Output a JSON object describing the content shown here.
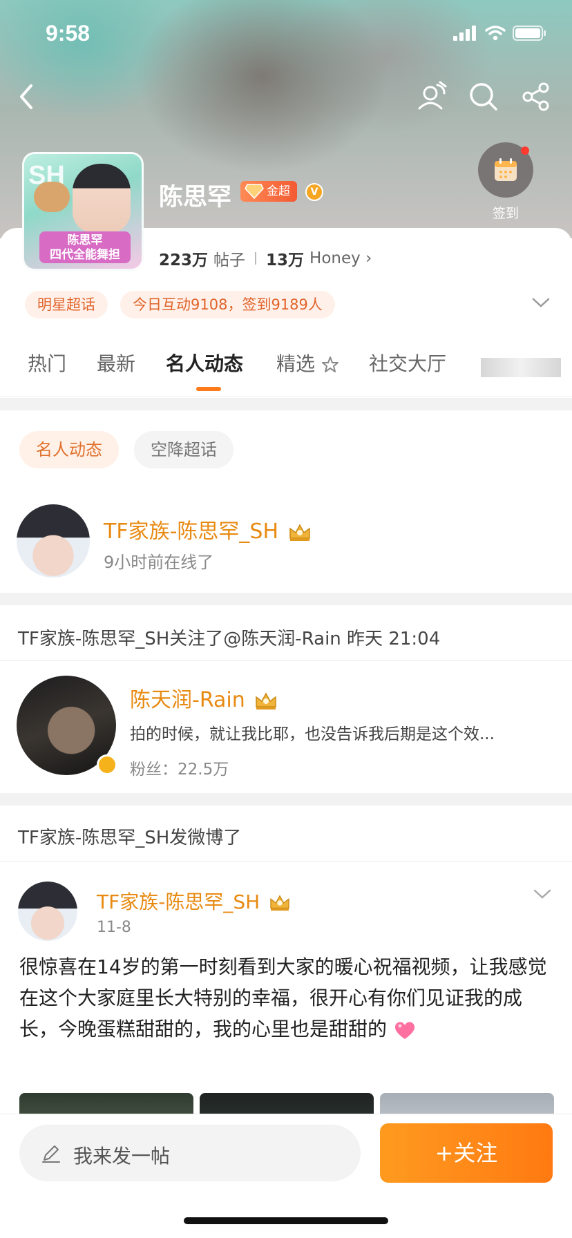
{
  "status_bar": {
    "time": "9:58"
  },
  "header": {
    "name": "陈思罕",
    "badge": "金超",
    "checkin_label": "签到",
    "avatar_banner_line1": "陈思罕",
    "avatar_banner_line2": "四代全能舞担",
    "avatar_letters": "SH",
    "icons": [
      "back-icon",
      "user-chat-icon",
      "search-icon",
      "share-icon",
      "calendar-icon"
    ]
  },
  "stats": {
    "posts_count": "223万",
    "posts_label": "帖子",
    "fans_count": "13万",
    "fans_label": "Honey",
    "fans_arrow": "›"
  },
  "chips": [
    {
      "label": "明星超话"
    },
    {
      "label": "今日互动9108，签到9189人"
    }
  ],
  "tabs": [
    {
      "label": "热门"
    },
    {
      "label": "最新"
    },
    {
      "label": "名人动态",
      "active": true
    },
    {
      "label": "精选"
    },
    {
      "label": "社交大厅"
    }
  ],
  "filters": [
    {
      "label": "名人动态",
      "selected": true
    },
    {
      "label": "空降超话",
      "selected": false
    }
  ],
  "celebrity": {
    "name": "TF家族-陈思罕_SH",
    "online": "9小时前在线了"
  },
  "follow_event": {
    "text": "TF家族-陈思罕_SH关注了@陈天润-Rain 昨天 21:04",
    "user_name": "陈天润-Rain",
    "user_bio": "拍的时候，就让我比耶，也没告诉我后期是这个效...",
    "user_fans": "粉丝：22.5万"
  },
  "post_event": {
    "head": "TF家族-陈思罕_SH发微博了",
    "author": "TF家族-陈思罕_SH",
    "date": "11-8",
    "text": "很惊喜在14岁的第一时刻看到大家的暖心祝福视频，让我感觉在这个大家庭里长大特别的幸福，很开心有你们见证我的成长，今晚蛋糕甜甜的，我的心里也是甜甜的"
  },
  "bottom": {
    "compose_placeholder": "我来发一帖",
    "follow_label": "+关注"
  },
  "colors": {
    "accent_orange": "#ff7a1a",
    "name_orange": "#e88a12",
    "chip_bg": "#fff1ea"
  }
}
